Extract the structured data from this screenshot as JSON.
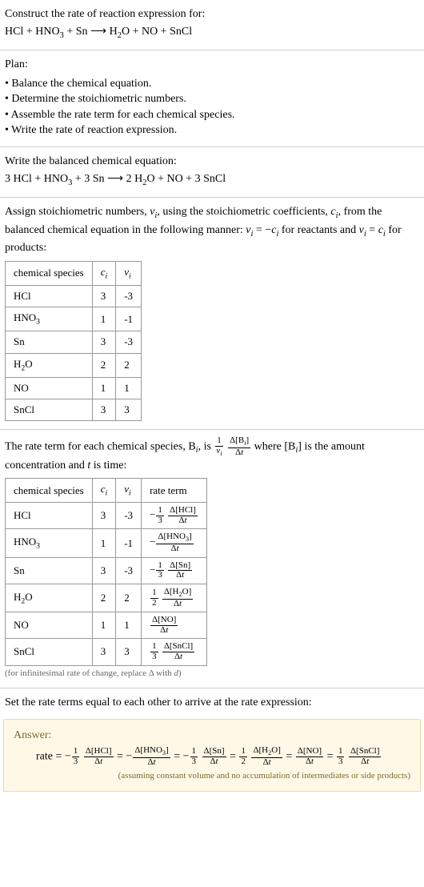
{
  "prompt": {
    "heading": "Construct the rate of reaction expression for:",
    "equation_html": "HCl + HNO<sub>3</sub> + Sn  ⟶  H<sub>2</sub>O + NO + SnCl"
  },
  "plan": {
    "heading": "Plan:",
    "items": [
      "Balance the chemical equation.",
      "Determine the stoichiometric numbers.",
      "Assemble the rate term for each chemical species.",
      "Write the rate of reaction expression."
    ]
  },
  "balanced": {
    "heading": "Write the balanced chemical equation:",
    "equation_html": "3 HCl + HNO<sub>3</sub> + 3 Sn  ⟶  2 H<sub>2</sub>O + NO + 3 SnCl"
  },
  "assign": {
    "text_html": "Assign stoichiometric numbers, <span class=\"ital\">ν<sub>i</sub></span>, using the stoichiometric coefficients, <span class=\"ital\">c<sub>i</sub></span>, from the balanced chemical equation in the following manner: <span class=\"ital\">ν<sub>i</sub></span> = −<span class=\"ital\">c<sub>i</sub></span> for reactants and <span class=\"ital\">ν<sub>i</sub></span> = <span class=\"ital\">c<sub>i</sub></span> for products:",
    "headers": {
      "species": "chemical species",
      "c": "c_i_html",
      "v": "v_i_html"
    },
    "c_header_html": "<span class=\"ital\">c<sub>i</sub></span>",
    "v_header_html": "<span class=\"ital\">ν<sub>i</sub></span>",
    "rows": [
      {
        "species_html": "HCl",
        "c": "3",
        "v": "-3"
      },
      {
        "species_html": "HNO<sub>3</sub>",
        "c": "1",
        "v": "-1"
      },
      {
        "species_html": "Sn",
        "c": "3",
        "v": "-3"
      },
      {
        "species_html": "H<sub>2</sub>O",
        "c": "2",
        "v": "2"
      },
      {
        "species_html": "NO",
        "c": "1",
        "v": "1"
      },
      {
        "species_html": "SnCl",
        "c": "3",
        "v": "3"
      }
    ]
  },
  "rateterm": {
    "text_html": "The rate term for each chemical species, B<sub><span class=\"ital\">i</span></sub>, is <span class=\"frac\"><span class=\"num\">1</span><span class=\"den\"><span class=\"ital\">ν<sub>i</sub></span></span></span> <span class=\"frac\"><span class=\"num\">Δ[B<sub><span class=\"ital\">i</span></sub>]</span><span class=\"den\">Δ<span class=\"ital\">t</span></span></span> where [B<sub><span class=\"ital\">i</span></sub>] is the amount concentration and <span class=\"ital\">t</span> is time:",
    "headers": {
      "species": "chemical species",
      "rate": "rate term"
    },
    "c_header_html": "<span class=\"ital\">c<sub>i</sub></span>",
    "v_header_html": "<span class=\"ital\">ν<sub>i</sub></span>",
    "rows": [
      {
        "species_html": "HCl",
        "c": "3",
        "v": "-3",
        "rate_html": "−<span class=\"frac\"><span class=\"num\">1</span><span class=\"den\">3</span></span> <span class=\"frac\"><span class=\"num\">Δ[HCl]</span><span class=\"den\">Δ<span class=\"ital\">t</span></span></span>"
      },
      {
        "species_html": "HNO<sub>3</sub>",
        "c": "1",
        "v": "-1",
        "rate_html": "−<span class=\"frac\"><span class=\"num\">Δ[HNO<sub>3</sub>]</span><span class=\"den\">Δ<span class=\"ital\">t</span></span></span>"
      },
      {
        "species_html": "Sn",
        "c": "3",
        "v": "-3",
        "rate_html": "−<span class=\"frac\"><span class=\"num\">1</span><span class=\"den\">3</span></span> <span class=\"frac\"><span class=\"num\">Δ[Sn]</span><span class=\"den\">Δ<span class=\"ital\">t</span></span></span>"
      },
      {
        "species_html": "H<sub>2</sub>O",
        "c": "2",
        "v": "2",
        "rate_html": "<span class=\"frac\"><span class=\"num\">1</span><span class=\"den\">2</span></span> <span class=\"frac\"><span class=\"num\">Δ[H<sub>2</sub>O]</span><span class=\"den\">Δ<span class=\"ital\">t</span></span></span>"
      },
      {
        "species_html": "NO",
        "c": "1",
        "v": "1",
        "rate_html": "<span class=\"frac\"><span class=\"num\">Δ[NO]</span><span class=\"den\">Δ<span class=\"ital\">t</span></span></span>"
      },
      {
        "species_html": "SnCl",
        "c": "3",
        "v": "3",
        "rate_html": "<span class=\"frac\"><span class=\"num\">1</span><span class=\"den\">3</span></span> <span class=\"frac\"><span class=\"num\">Δ[SnCl]</span><span class=\"den\">Δ<span class=\"ital\">t</span></span></span>"
      }
    ],
    "note_html": "(for infinitesimal rate of change, replace Δ with <span class=\"ital\">d</span>)"
  },
  "final": {
    "text": "Set the rate terms equal to each other to arrive at the rate expression:"
  },
  "answer": {
    "title": "Answer:",
    "expr_html": "rate = −<span class=\"frac\"><span class=\"num\">1</span><span class=\"den\">3</span></span> <span class=\"frac\"><span class=\"num\">Δ[HCl]</span><span class=\"den\">Δ<span class=\"ital\">t</span></span></span> = −<span class=\"frac\"><span class=\"num\">Δ[HNO<sub>3</sub>]</span><span class=\"den\">Δ<span class=\"ital\">t</span></span></span> = −<span class=\"frac\"><span class=\"num\">1</span><span class=\"den\">3</span></span> <span class=\"frac\"><span class=\"num\">Δ[Sn]</span><span class=\"den\">Δ<span class=\"ital\">t</span></span></span> = <span class=\"frac\"><span class=\"num\">1</span><span class=\"den\">2</span></span> <span class=\"frac\"><span class=\"num\">Δ[H<sub>2</sub>O]</span><span class=\"den\">Δ<span class=\"ital\">t</span></span></span> = <span class=\"frac\"><span class=\"num\">Δ[NO]</span><span class=\"den\">Δ<span class=\"ital\">t</span></span></span> = <span class=\"frac\"><span class=\"num\">1</span><span class=\"den\">3</span></span> <span class=\"frac\"><span class=\"num\">Δ[SnCl]</span><span class=\"den\">Δ<span class=\"ital\">t</span></span></span>",
    "note": "(assuming constant volume and no accumulation of intermediates or side products)"
  },
  "chart_data": {
    "type": "table",
    "tables": [
      {
        "title": "Stoichiometric numbers",
        "columns": [
          "chemical species",
          "c_i",
          "ν_i"
        ],
        "rows": [
          [
            "HCl",
            3,
            -3
          ],
          [
            "HNO3",
            1,
            -1
          ],
          [
            "Sn",
            3,
            -3
          ],
          [
            "H2O",
            2,
            2
          ],
          [
            "NO",
            1,
            1
          ],
          [
            "SnCl",
            3,
            3
          ]
        ]
      },
      {
        "title": "Rate terms",
        "columns": [
          "chemical species",
          "c_i",
          "ν_i",
          "rate term"
        ],
        "rows": [
          [
            "HCl",
            3,
            -3,
            "-(1/3) Δ[HCl]/Δt"
          ],
          [
            "HNO3",
            1,
            -1,
            "-Δ[HNO3]/Δt"
          ],
          [
            "Sn",
            3,
            -3,
            "-(1/3) Δ[Sn]/Δt"
          ],
          [
            "H2O",
            2,
            2,
            "(1/2) Δ[H2O]/Δt"
          ],
          [
            "NO",
            1,
            1,
            "Δ[NO]/Δt"
          ],
          [
            "SnCl",
            3,
            3,
            "(1/3) Δ[SnCl]/Δt"
          ]
        ]
      }
    ]
  }
}
